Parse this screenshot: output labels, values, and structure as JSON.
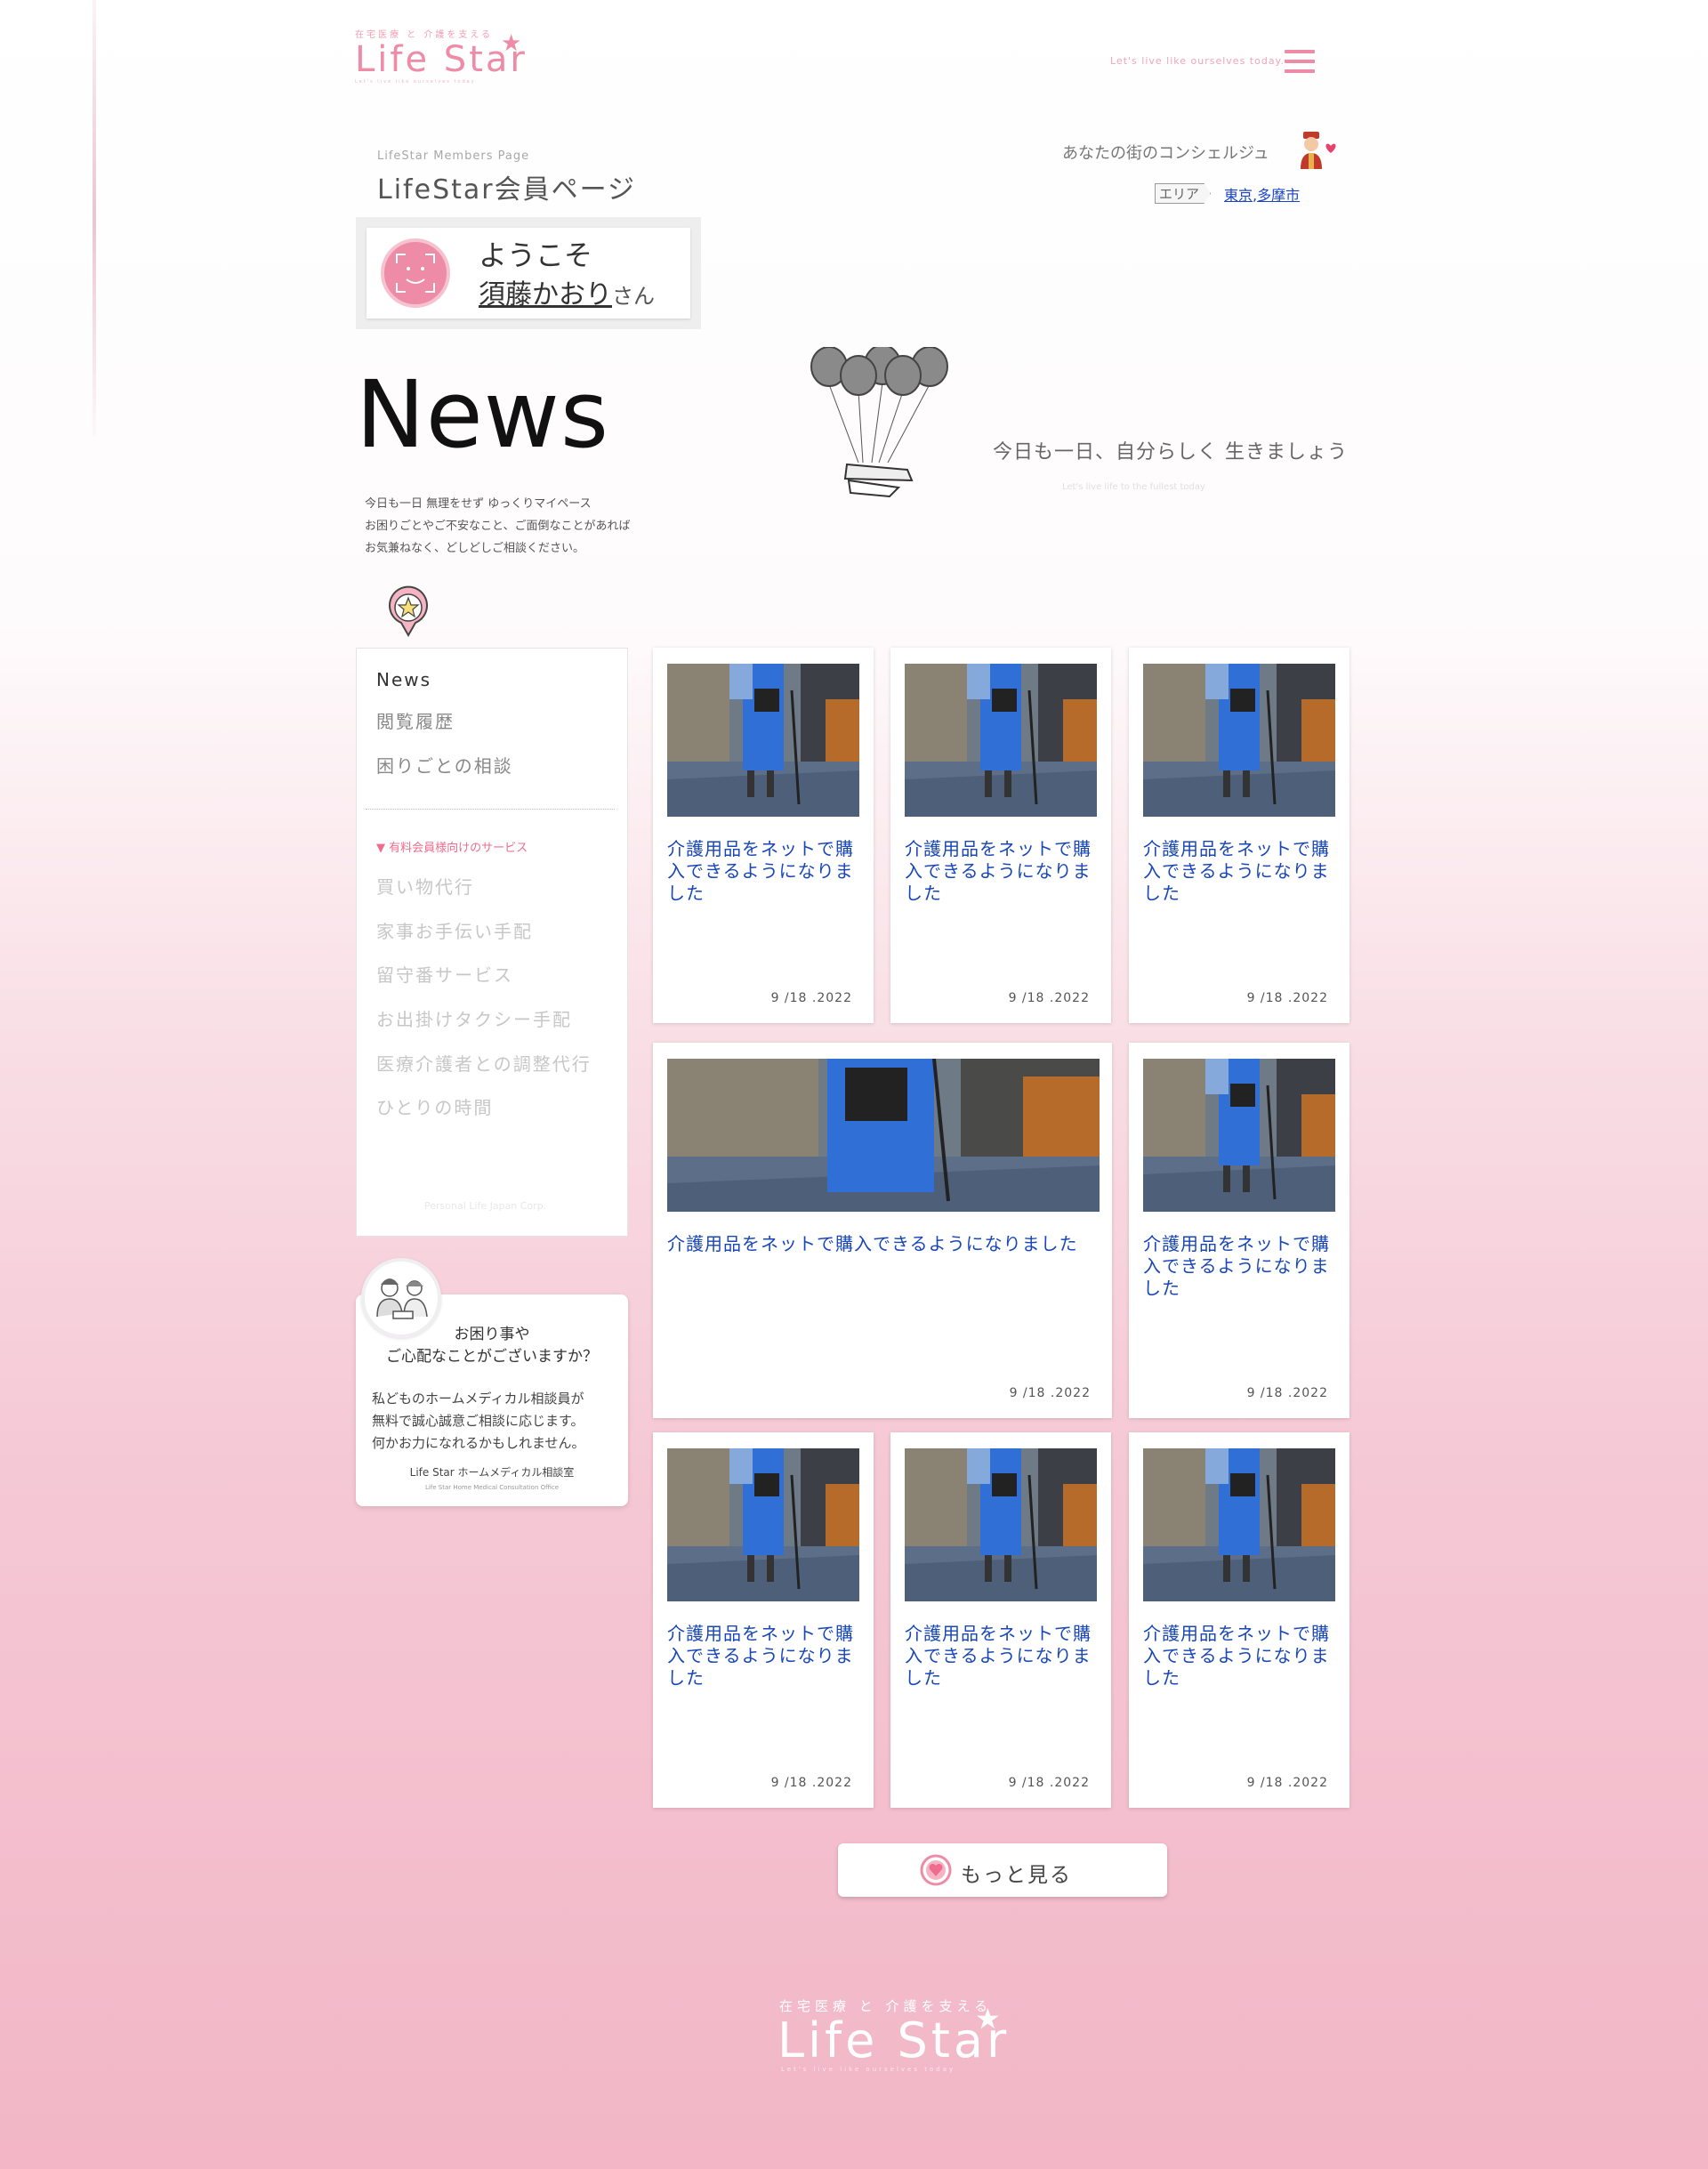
{
  "header": {
    "logo_small": "在宅医療 と 介護を支える",
    "logo_main": "Life Star",
    "logo_tag": "Let's live like ourselves today",
    "tagline": "Let's live like ourselves today."
  },
  "page": {
    "members_en": "LifeStar Members Page",
    "members_jp": "LifeStar会員ページ"
  },
  "concierge": {
    "text": "あなたの街のコンシェルジュ",
    "area_label": "エリア",
    "areas": [
      "東京",
      "多摩市"
    ],
    "area_sep": ","
  },
  "welcome": {
    "greeting": "ようこそ",
    "name": "須藤かおり",
    "honorific": "さん"
  },
  "news": {
    "title": "News",
    "desc": [
      "今日も一日 無理をせず ゆっくりマイペース",
      "お困りごとやご不安なこと、ご面倒なことがあれば",
      "お気兼ねなく、どしどしご相談ください。"
    ],
    "motto": "今日も一日、自分らしく 生きましょう",
    "motto_en": "Let's live life to the fullest today"
  },
  "sidebar": {
    "items": [
      "News",
      "閲覧履歴",
      "困りごとの相談"
    ],
    "section": "▼ 有料会員様向けのサービス",
    "services": [
      "買い物代行",
      "家事お手伝い手配",
      "留守番サービス",
      "お出掛けタクシー手配",
      "医療介護者との調整代行",
      "ひとりの時間"
    ],
    "corp": "Personal Life Japan Corp."
  },
  "consult": {
    "question": [
      "お困り事や",
      "ご心配なことがございますか？"
    ],
    "body": [
      "私どものホームメディカル相談員が",
      "無料で誠心誠意ご相談に応じます。",
      "何かお力になれるかもしれません。"
    ],
    "office": "Life Star ホームメディカル相談室",
    "office_en": "Life Star Home Medical Consultation Office"
  },
  "cards": [
    {
      "title": "介護用品をネットで購入できるようになりました",
      "date": "9 /18 .2022"
    },
    {
      "title": "介護用品をネットで購入できるようになりました",
      "date": "9 /18 .2022"
    },
    {
      "title": "介護用品をネットで購入できるようになりました",
      "date": "9 /18 .2022"
    },
    {
      "title": "介護用品をネットで購入できるようになりました",
      "date": "9 /18 .2022"
    },
    {
      "title": "介護用品をネットで購入できるようになりました",
      "date": "9 /18 .2022"
    },
    {
      "title": "介護用品をネットで購入できるようになりました",
      "date": "9 /18 .2022"
    },
    {
      "title": "介護用品をネットで購入できるようになりました",
      "date": "9 /18 .2022"
    },
    {
      "title": "介護用品をネットで購入できるようになりました",
      "date": "9 /18 .2022"
    }
  ],
  "more": {
    "label": "もっと見る"
  },
  "footer": {
    "logo_small": "在宅医療 と 介護を支える",
    "logo_main": "Life Star",
    "logo_tag": "Let's live like ourselves today"
  },
  "colors": {
    "brand_pink": "#ee8ba6",
    "link_blue": "#1947b8"
  },
  "icons": [
    "menu-icon",
    "concierge-icon",
    "face-icon",
    "balloons-icon",
    "star-pin-icon",
    "consult-avatar-icon",
    "heart-icon",
    "star-icon"
  ]
}
